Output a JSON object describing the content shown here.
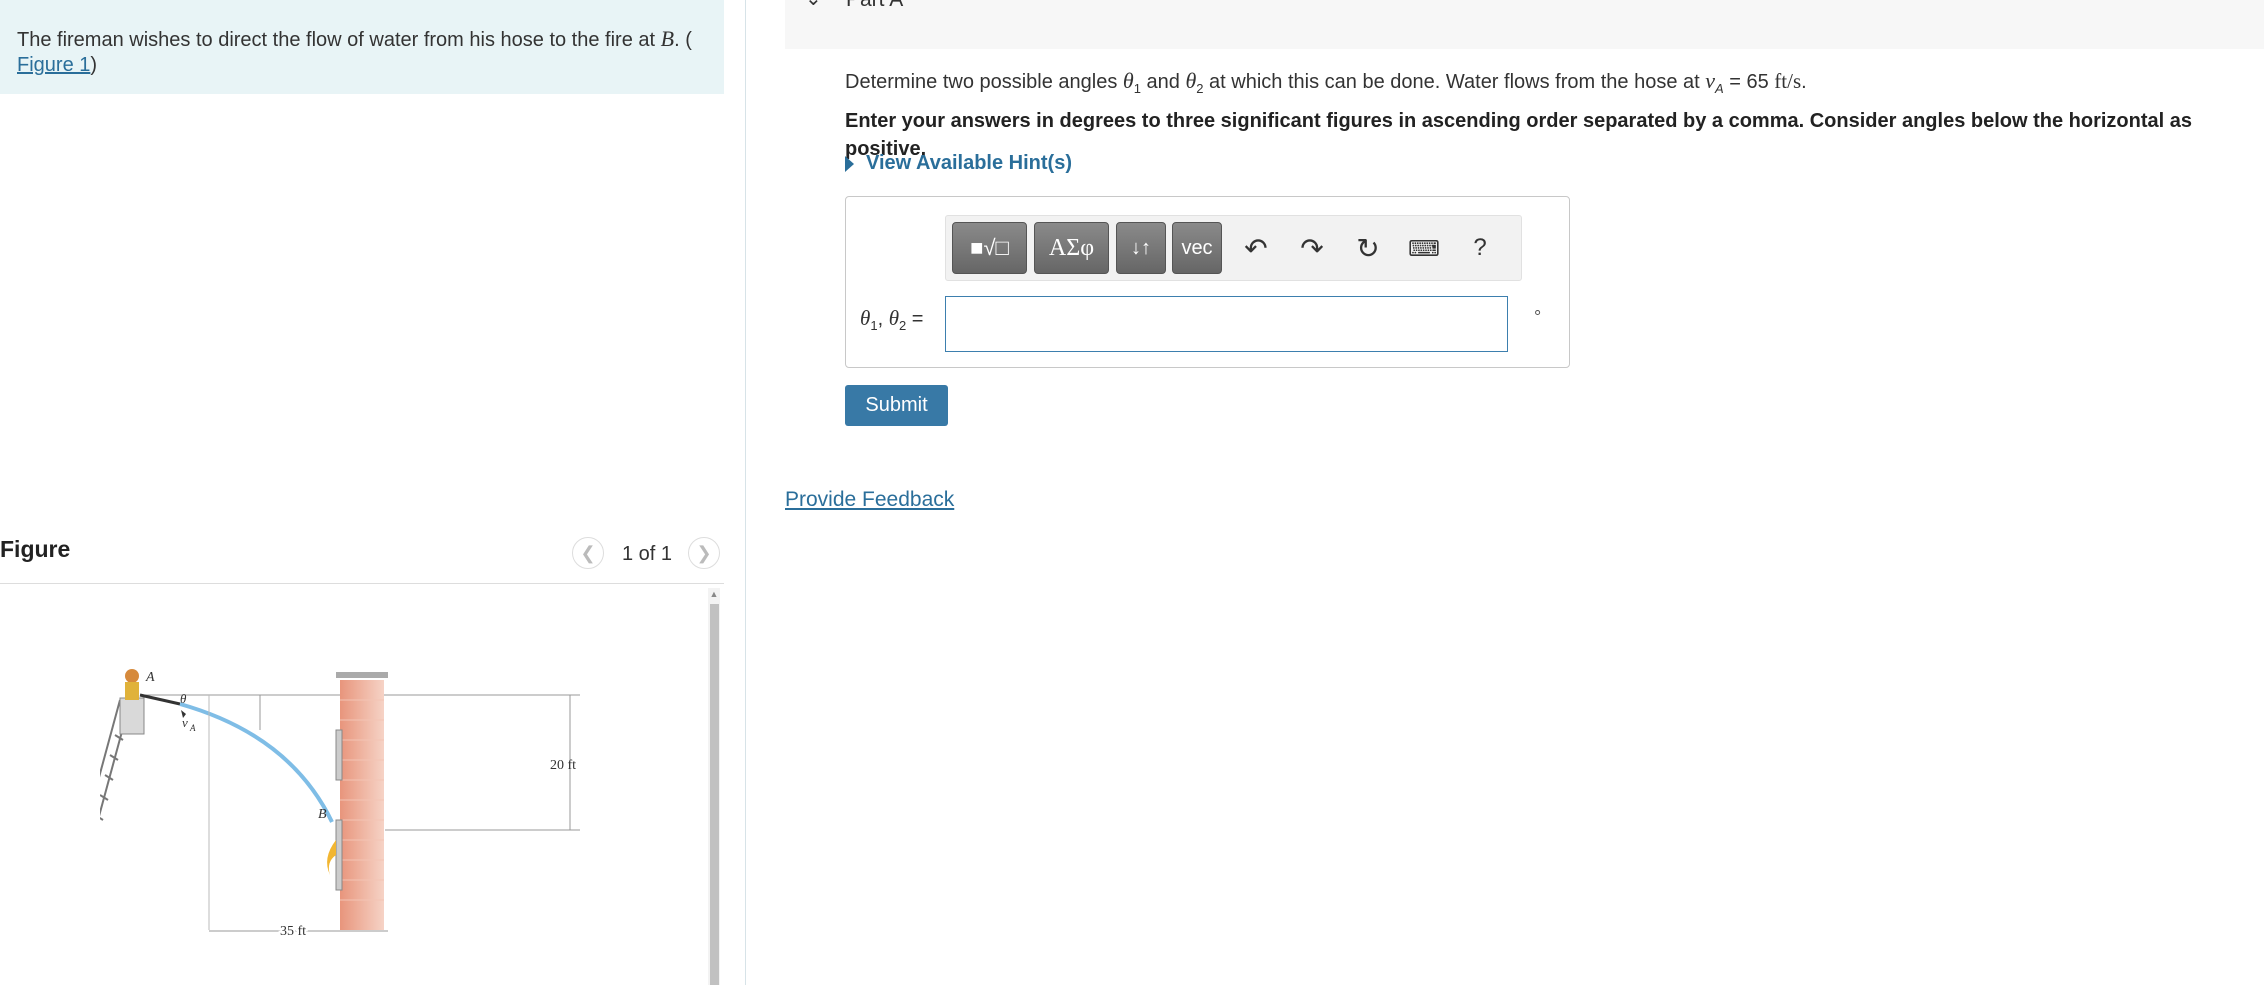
{
  "problem": {
    "text_before": "The fireman wishes to direct the flow of water from his hose to the fire at ",
    "point": "B",
    "text_after": ". (",
    "figure_link": "Figure 1",
    "close_paren": ")"
  },
  "figure": {
    "title": "Figure",
    "pager": "1 of 1",
    "prev_icon": "chevron-left",
    "next_icon": "chevron-right",
    "labels": {
      "point_a": "A",
      "angle": "θ",
      "velocity": "v",
      "velocity_sub": "A",
      "point_b": "B",
      "height": "20 ft",
      "distance": "35 ft"
    }
  },
  "part": {
    "title": "Part A",
    "question_pre": "Determine two possible angles ",
    "theta1": "θ",
    "theta1_sub": "1",
    "and": " and ",
    "theta2": "θ",
    "theta2_sub": "2",
    "question_mid": " at which this can be done. Water flows from the hose at ",
    "va": "v",
    "va_sub": "A",
    "equals": " = 65 ",
    "unit": "ft/s",
    "period": ".",
    "instruction": "Enter your answers in degrees to three significant figures in ascending order separated by a comma. Consider angles below the horizontal as positive.",
    "hints_label": "View Available Hint(s)"
  },
  "toolbar": {
    "template_icon": "radical-template-icon",
    "greek_label": "ΑΣφ",
    "arrows_label": "↓↑",
    "vec_label": "vec",
    "undo_icon": "undo",
    "redo_icon": "redo",
    "reset_icon": "reset",
    "keyboard_icon": "keyboard",
    "help_label": "?"
  },
  "answer": {
    "label_theta": "θ",
    "label_sub1": "1",
    "label_sep": ", ",
    "label_sub2": "2",
    "label_eq": " =",
    "value": "",
    "unit": "°"
  },
  "submit_label": "Submit",
  "feedback_label": "Provide Feedback",
  "colors": {
    "accent": "#3879a6",
    "link": "#2a6e9a",
    "problem_bg": "#e8f4f6",
    "water": "#7fbde6",
    "brick": "#e8a08a"
  }
}
